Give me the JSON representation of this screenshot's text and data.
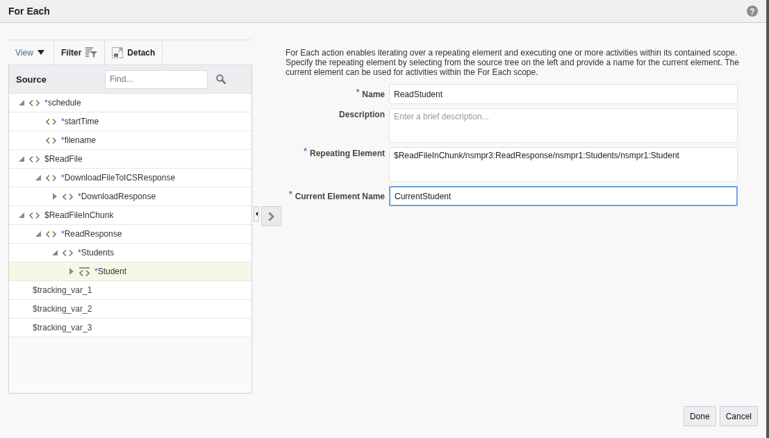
{
  "window": {
    "title": "For Each",
    "help": "?"
  },
  "toolbar": {
    "view": "View",
    "filter": "Filter",
    "detach": "Detach"
  },
  "source": {
    "heading": "Source",
    "search": {
      "placeholder": "Find..."
    },
    "items": [
      {
        "kind": "element",
        "marker": "*",
        "name": "schedule",
        "expanded": true,
        "selected": false,
        "children": [
          {
            "kind": "element",
            "marker": "*",
            "name": "startTime",
            "selected": false
          },
          {
            "kind": "element",
            "marker": "*",
            "name": "filename",
            "selected": false
          }
        ]
      },
      {
        "kind": "element",
        "name": "$ReadFile",
        "expanded": true,
        "selected": false,
        "children": [
          {
            "kind": "element",
            "marker": "*",
            "name": "DownloadFileToICSResponse",
            "expanded": true,
            "selected": false,
            "children": [
              {
                "kind": "element",
                "marker": "*",
                "name": "DownloadResponse",
                "expanded": false,
                "selected": false
              }
            ]
          }
        ]
      },
      {
        "kind": "element",
        "name": "$ReadFileInChunk",
        "expanded": true,
        "selected": false,
        "children": [
          {
            "kind": "element",
            "marker": "*",
            "name": "ReadResponse",
            "expanded": true,
            "selected": false,
            "children": [
              {
                "kind": "element",
                "marker": "*",
                "name": "Students",
                "expanded": true,
                "selected": false,
                "children": [
                  {
                    "kind": "repeating",
                    "marker": "*",
                    "name": "Student",
                    "expanded": false,
                    "selected": true
                  }
                ]
              }
            ]
          }
        ]
      },
      {
        "kind": "variable",
        "name": "$tracking_var_1",
        "selected": false
      },
      {
        "kind": "variable",
        "name": "$tracking_var_2",
        "selected": false
      },
      {
        "kind": "variable",
        "name": "$tracking_var_3",
        "selected": false
      }
    ]
  },
  "description": "For Each action enables iterating over a repeating element and executing one or more activities within its contained scope. Specify the repeating element by selecting from the source tree on the left and provide a name for the current element. The current element can be used for activities within the For Each scope.",
  "fields": [
    {
      "label": "Name",
      "required": true,
      "value": "ReadStudent",
      "multiline": false,
      "focused": false
    },
    {
      "label": "Description",
      "required": false,
      "placeholder": "Enter a brief description...",
      "multiline": true,
      "focused": false
    },
    {
      "label": "Repeating Element",
      "required": true,
      "value": "$ReadFileInChunk/nsmpr3:ReadResponse/nsmpr1:Students/nsmpr1:Student",
      "multiline": true,
      "focused": false
    },
    {
      "label": "Current Element Name",
      "required": true,
      "value": "CurrentStudent",
      "multiline": false,
      "focused": true
    }
  ],
  "buttons": [
    "Done",
    "Cancel"
  ]
}
